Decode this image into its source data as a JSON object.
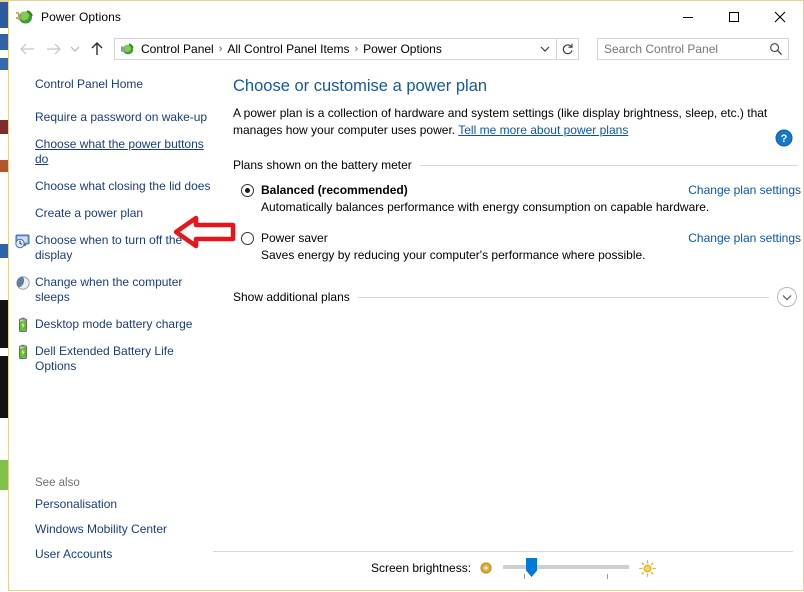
{
  "window": {
    "title": "Power Options",
    "app_icon": "power-options-icon",
    "minimize_label": "Minimize",
    "maximize_label": "Maximize",
    "close_label": "Close"
  },
  "nav": {
    "back_label": "Back",
    "forward_label": "Forward",
    "recent_label": "Recent locations",
    "up_label": "Up one level",
    "refresh_label": "Refresh",
    "breadcrumbs": [
      "Control Panel",
      "All Control Panel Items",
      "Power Options"
    ],
    "separator": "›",
    "dropdown_label": "Previous locations"
  },
  "search": {
    "placeholder": "Search Control Panel",
    "value": "",
    "icon": "search-icon"
  },
  "sidebar": {
    "items": [
      {
        "label": "Control Panel Home",
        "icon": null,
        "underlined": false
      },
      {
        "label": "Require a password on wake-up",
        "icon": null,
        "underlined": false
      },
      {
        "label": "Choose what the power buttons do",
        "icon": null,
        "underlined": true
      },
      {
        "label": "Choose what closing the lid does",
        "icon": null,
        "underlined": false
      },
      {
        "label": "Create a power plan",
        "icon": null,
        "underlined": false
      },
      {
        "label": "Choose when to turn off the display",
        "icon": "display-clock-icon",
        "underlined": false
      },
      {
        "label": "Change when the computer sleeps",
        "icon": "sleep-moon-icon",
        "underlined": false
      },
      {
        "label": "Desktop mode battery charge",
        "icon": "battery-shield-icon",
        "underlined": false
      },
      {
        "label": "Dell Extended Battery Life Options",
        "icon": "battery-shield-icon",
        "underlined": false
      }
    ],
    "see_also_label": "See also",
    "see_also": [
      {
        "label": "Personalisation"
      },
      {
        "label": "Windows Mobility Center"
      },
      {
        "label": "User Accounts"
      }
    ]
  },
  "annotation": {
    "shape": "left-arrow-callout",
    "color": "#e4181b",
    "points_to": "Choose what the power buttons do"
  },
  "main": {
    "help_label": "Help",
    "title": "Choose or customise a power plan",
    "description_part1": "A power plan is a collection of hardware and system settings (like display brightness, sleep, etc.) that manages how your computer uses power. ",
    "description_link": "Tell me more about power plans",
    "group_label": "Plans shown on the battery meter",
    "plans": [
      {
        "name": "Balanced (recommended)",
        "selected": true,
        "description": "Automatically balances performance with energy consumption on capable hardware.",
        "change_link": "Change plan settings"
      },
      {
        "name": "Power saver",
        "selected": false,
        "description": "Saves energy by reducing your computer's performance where possible.",
        "change_link": "Change plan settings"
      }
    ],
    "show_additional_label": "Show additional plans",
    "show_additional_icon": "chevron-down-icon"
  },
  "brightness": {
    "label": "Screen brightness:",
    "dim_icon": "dim-sun-icon",
    "bright_icon": "bright-sun-icon",
    "value_percent": 20
  },
  "colors": {
    "accent_link": "#0d56a6",
    "sidebar_link": "#1a3d7c",
    "heading": "#13599b",
    "annotation_red": "#e4181b",
    "slider_thumb": "#0078d7",
    "window_border": "#e8cf93",
    "help_blue": "#1878c8"
  }
}
